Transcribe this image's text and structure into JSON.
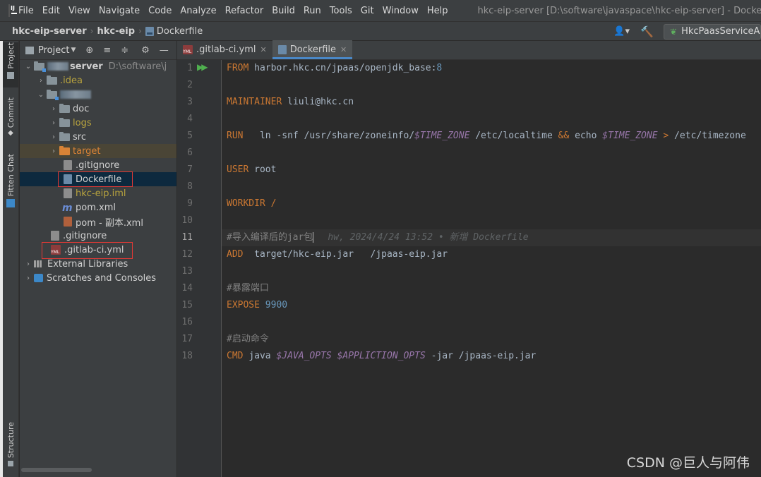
{
  "menu": {
    "items": [
      "File",
      "Edit",
      "View",
      "Navigate",
      "Code",
      "Analyze",
      "Refactor",
      "Build",
      "Run",
      "Tools",
      "Git",
      "Window",
      "Help"
    ],
    "window_title": "hkc-eip-server [D:\\software\\javaspace\\hkc-eip-server] - Dockerfile [hkc-eip]"
  },
  "breadcrumb": {
    "project": "hkc-eip-server",
    "module": "hkc-eip",
    "file": "Dockerfile"
  },
  "toolbar": {
    "run_config": "HkcPaasServiceApp"
  },
  "left_stripe": {
    "project": "Project",
    "commit": "Commit",
    "fitten": "Fitten Chat",
    "structure": "Structure"
  },
  "project_panel": {
    "title": "Project",
    "tree": {
      "root_suffix": "server",
      "root_path": "D:\\software\\j",
      "idea": ".idea",
      "doc": "doc",
      "logs": "logs",
      "src": "src",
      "target": "target",
      "gitignore_inner": ".gitignore",
      "dockerfile": "Dockerfile",
      "iml": "hkc-eip.iml",
      "pom": "pom.xml",
      "pom_copy": "pom - 副本.xml",
      "gitignore_root": ".gitignore",
      "gitlab_ci": ".gitlab-ci.yml",
      "ext_libs": "External Libraries",
      "scratches": "Scratches and Consoles"
    }
  },
  "editor": {
    "tabs": [
      {
        "label": ".gitlab-ci.yml",
        "active": false
      },
      {
        "label": "Dockerfile",
        "active": true
      }
    ],
    "line_count": 18,
    "current_line": 11,
    "lines": {
      "l1": {
        "kw": "FROM",
        "rest": "harbor.hkc.cn/jpaas/openjdk_base:",
        "num": "8"
      },
      "l3": {
        "kw": "MAINTAINER",
        "rest": "liuli@hkc.cn"
      },
      "l5": {
        "kw": "RUN",
        "a": "   ln -snf /usr/share/zoneinfo/",
        "v1": "$TIME_ZONE",
        "b": " /etc/localtime ",
        "amp": "&&",
        "c": " echo ",
        "v2": "$TIME_ZONE",
        "d": " ",
        "gt": ">",
        "e": " /etc/timezone"
      },
      "l7": {
        "kw": "USER",
        "rest": "root"
      },
      "l9": {
        "kw": "WORKDIR",
        "rest": "/"
      },
      "l11": {
        "comment": "#导入编译后的jar包",
        "blame": "hw, 2024/4/24 13:52 • 新增 Dockerfile"
      },
      "l12": {
        "kw": "ADD",
        "rest": "target/hkc-eip.jar   /jpaas-eip.jar"
      },
      "l14": {
        "comment": "#暴露端口"
      },
      "l15": {
        "kw": "EXPOSE",
        "num": "9900"
      },
      "l17": {
        "comment": "#启动命令"
      },
      "l18": {
        "kw": "CMD",
        "a": "java ",
        "v1": "$JAVA_OPTS",
        "b": " ",
        "v2": "$APPLICTION_OPTS",
        "c": " -jar /jpaas-eip.jar"
      }
    }
  },
  "watermark": "CSDN @巨人与阿伟"
}
